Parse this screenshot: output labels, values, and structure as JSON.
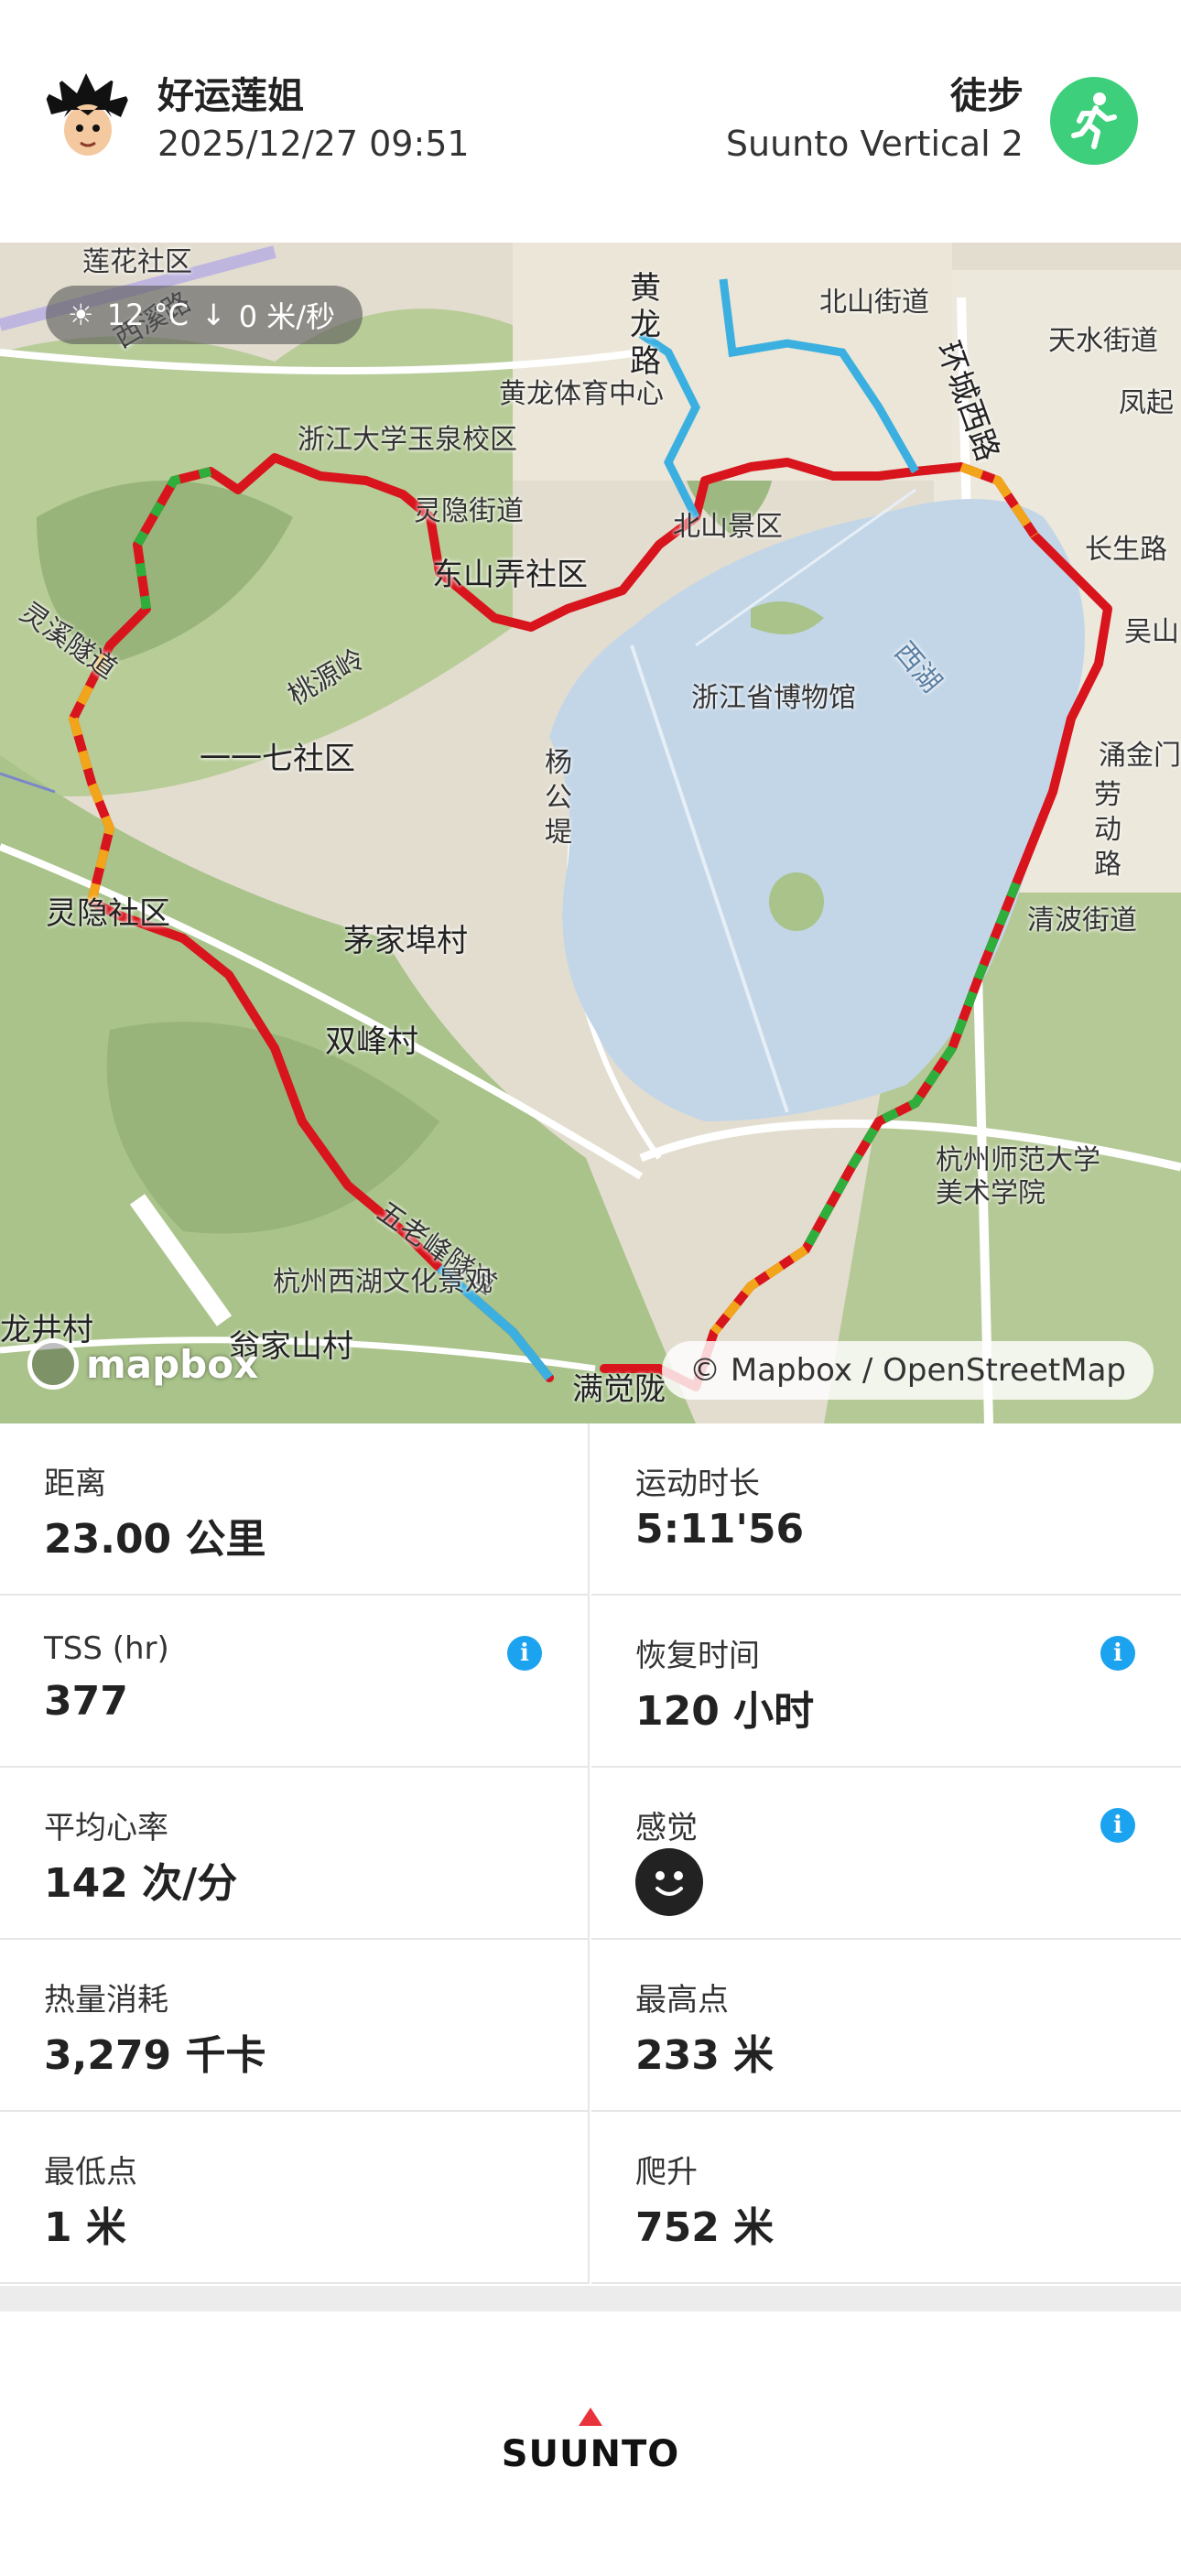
{
  "header": {
    "user_name": "好运莲姐",
    "datetime": "2025/12/27 09:51",
    "sport": "徒步",
    "device": "Suunto Vertical 2",
    "sport_icon": "hiking-icon",
    "sport_icon_color": "#3ecf7c"
  },
  "map": {
    "weather": {
      "icon": "sun-icon",
      "temperature": "12 °C",
      "wind_icon": "wind-arrow-icon",
      "wind": "0 米/秒"
    },
    "attribution": "© Mapbox / OpenStreetMap",
    "logo": "mapbox",
    "labels": [
      "莲花社区",
      "西溪路",
      "黄龙体育中心",
      "浙江大学玉泉校区",
      "灵隐街道",
      "北山街道",
      "天水街道",
      "凤起",
      "环城西路",
      "北山景区",
      "东山弄社区",
      "长生路",
      "灵溪隧道",
      "桃源岭",
      "浙江省博物馆",
      "西湖",
      "一一七社区",
      "杨公堤",
      "涌金门",
      "劳动路",
      "灵隐社区",
      "茅家埠村",
      "清波街道",
      "双峰村",
      "杭州师范大学美术学院",
      "五老峰隧道",
      "杭州西湖文化景观",
      "龙井村",
      "翁家山村",
      "满觉陇",
      "黄龙路",
      "吴山"
    ],
    "route_colors": {
      "high": "#d8141c",
      "mid": "#f2a51a",
      "low": "#2fae3c",
      "rest": "#3bb0e0"
    }
  },
  "stats": [
    {
      "label": "距离",
      "value": "23.00 公里",
      "info": false
    },
    {
      "label": "运动时长",
      "value": "5:11'56",
      "info": false
    },
    {
      "label": "TSS (hr)",
      "value": "377",
      "info": true
    },
    {
      "label": "恢复时间",
      "value": "120 小时",
      "info": true
    },
    {
      "label": "平均心率",
      "value": "142 次/分",
      "info": false
    },
    {
      "label": "感觉",
      "value": "",
      "info": true,
      "icon": "smiley-face-icon"
    },
    {
      "label": "热量消耗",
      "value": "3,279 千卡",
      "info": false
    },
    {
      "label": "最高点",
      "value": "233 米",
      "info": false
    },
    {
      "label": "最低点",
      "value": "1 米",
      "info": false
    },
    {
      "label": "爬升",
      "value": "752 米",
      "info": false
    }
  ],
  "info_glyph": "i",
  "brand": "SUUNTO",
  "brand_color": "#e8323c"
}
